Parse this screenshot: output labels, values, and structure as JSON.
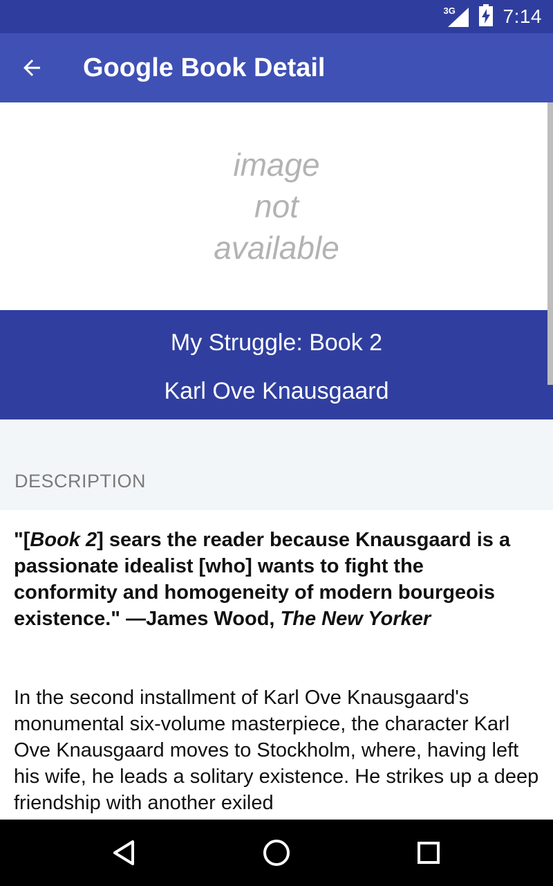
{
  "status_bar": {
    "network": "3G",
    "time": "7:14",
    "icons": [
      "signal-icon",
      "battery-charging-icon"
    ]
  },
  "app_bar": {
    "title": "Google Book Detail",
    "back_icon": "arrow-back-icon"
  },
  "cover": {
    "placeholder_lines": [
      "image",
      "not",
      "available"
    ]
  },
  "book": {
    "title": "My Struggle: Book 2",
    "author": "Karl Ove Knausgaard"
  },
  "description_section": {
    "label": "DESCRIPTION",
    "quote": {
      "p1": "\"[",
      "p2": "Book 2",
      "p3": "] sears the reader because Knausgaard is a passionate idealist [who] wants to fight the conformity and homogeneity of modern bourgeois existence.\" —James Wood, ",
      "p4": "The New Yorker"
    },
    "paragraph": "In the second installment of Karl Ove Knausgaard's monumental six-volume masterpiece, the character Karl Ove Knausgaard moves to Stockholm, where, having left his wife, he leads a solitary existence. He strikes up a deep friendship with another exiled"
  },
  "nav_bar": {
    "icons": [
      "back-triangle-icon",
      "home-circle-icon",
      "recents-square-icon"
    ]
  },
  "colors": {
    "status_bar": "#2f3e9e",
    "app_bar": "#3f51b5",
    "title_band": "#303f9f",
    "section_bg": "#f3f6f9",
    "placeholder_text": "#b3b3b3"
  }
}
